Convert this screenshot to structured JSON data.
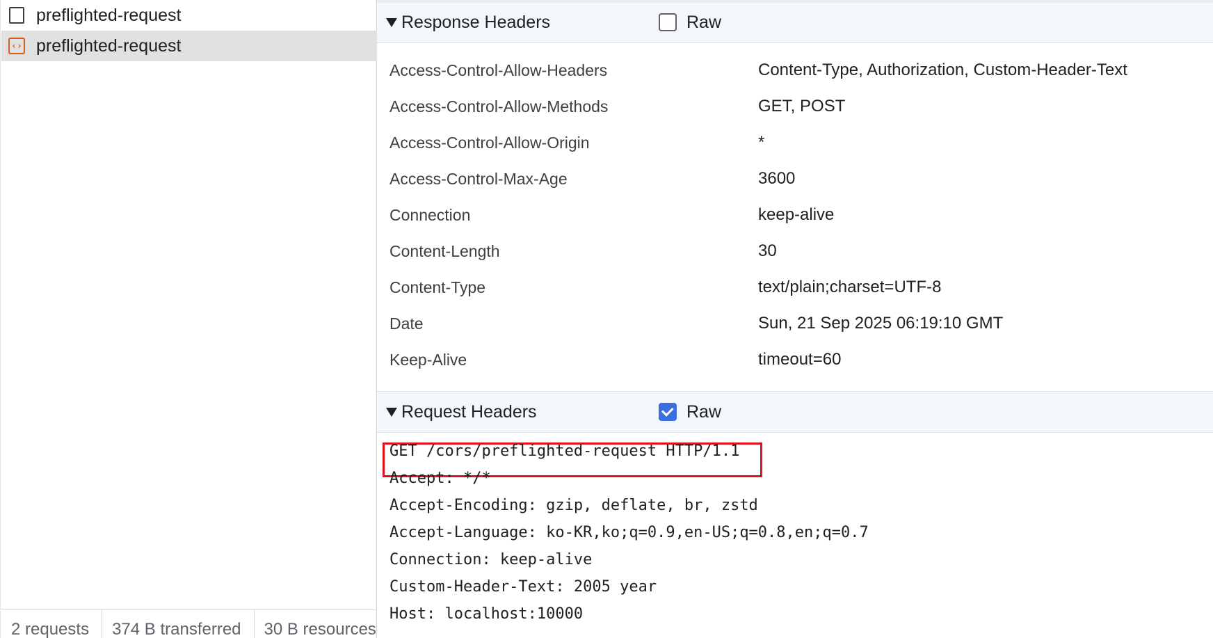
{
  "request_list": {
    "items": [
      {
        "name": "preflighted-request",
        "icon": "document-icon"
      },
      {
        "name": "preflighted-request",
        "icon": "xhr-icon"
      }
    ]
  },
  "status_bar": {
    "requests": "2 requests",
    "transferred": "374 B transferred",
    "resources": "30 B resources"
  },
  "response_headers": {
    "title": "Response Headers",
    "raw_label": "Raw",
    "raw_checked": false,
    "rows": [
      {
        "name": "Access-Control-Allow-Headers",
        "value": "Content-Type, Authorization, Custom-Header-Text"
      },
      {
        "name": "Access-Control-Allow-Methods",
        "value": "GET, POST"
      },
      {
        "name": "Access-Control-Allow-Origin",
        "value": "*"
      },
      {
        "name": "Access-Control-Max-Age",
        "value": "3600"
      },
      {
        "name": "Connection",
        "value": "keep-alive"
      },
      {
        "name": "Content-Length",
        "value": "30"
      },
      {
        "name": "Content-Type",
        "value": "text/plain;charset=UTF-8"
      },
      {
        "name": "Date",
        "value": "Sun, 21 Sep 2025 06:19:10 GMT"
      },
      {
        "name": "Keep-Alive",
        "value": "timeout=60"
      }
    ]
  },
  "request_headers": {
    "title": "Request Headers",
    "raw_label": "Raw",
    "raw_checked": true,
    "raw_lines": [
      "GET /cors/preflighted-request HTTP/1.1",
      "Accept: */*",
      "Accept-Encoding: gzip, deflate, br, zstd",
      "Accept-Language: ko-KR,ko;q=0.9,en-US;q=0.8,en;q=0.7",
      "Connection: keep-alive",
      "Custom-Header-Text: 2005 year",
      "Host: localhost:10000"
    ]
  },
  "colors": {
    "selected_row": "#e1e1e1",
    "section_header_bg": "#f3f6fb",
    "checkbox_checked": "#3b6fe0",
    "highlight_border": "#e0101d",
    "xhr_icon": "#d35f1d"
  }
}
